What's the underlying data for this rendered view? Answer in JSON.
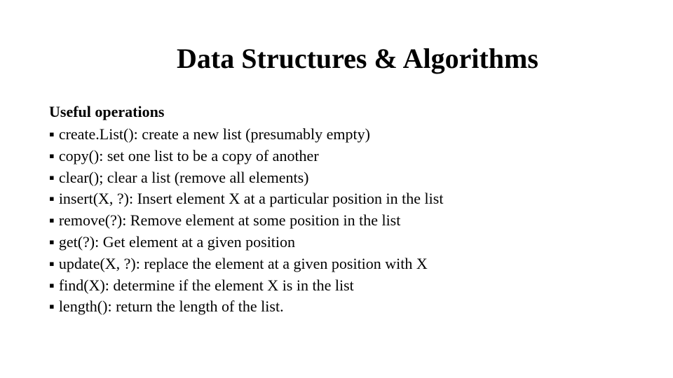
{
  "title": "Data Structures & Algorithms",
  "subtitle": "Useful operations",
  "bullets": [
    "create.List(): create a new list (presumably empty)",
    "copy(): set one list to be a copy of another",
    "clear(); clear a list (remove all elements)",
    "insert(X, ?): Insert element X at a particular position in the list",
    "remove(?): Remove element at some position in the list",
    "get(?): Get element at a given position",
    "update(X, ?): replace the element at a given position with X",
    "find(X): determine if the element X is in the list",
    "length(): return the length of the list."
  ]
}
